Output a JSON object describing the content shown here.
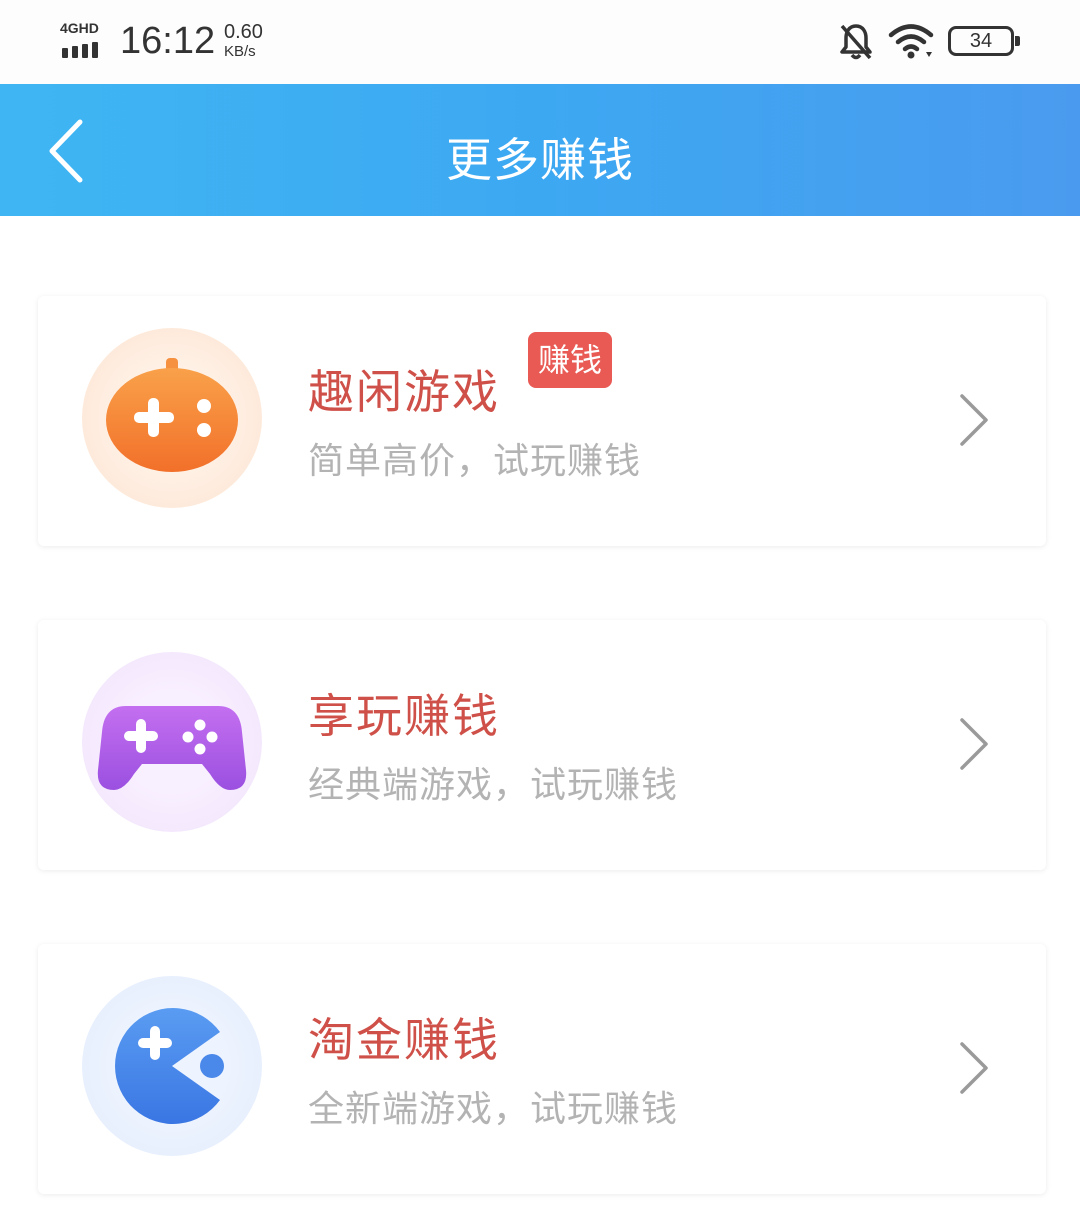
{
  "status_bar": {
    "network": "4GHD",
    "time": "16:12",
    "speed_value": "0.60",
    "speed_unit": "KB/s",
    "battery": "34"
  },
  "header": {
    "title": "更多赚钱"
  },
  "items": [
    {
      "title": "趣闲游戏",
      "subtitle": "简单高价，试玩赚钱",
      "badge": "赚钱",
      "icon": "orange-gamepad-icon",
      "accent": "#f47e2f"
    },
    {
      "title": "享玩赚钱",
      "subtitle": "经典端游戏，试玩赚钱",
      "icon": "purple-controller-icon",
      "accent": "#a25ae6"
    },
    {
      "title": "淘金赚钱",
      "subtitle": "全新端游戏，试玩赚钱",
      "icon": "blue-pacman-icon",
      "accent": "#3f84ea"
    }
  ],
  "colors": {
    "header_start": "#3fb6f3",
    "header_end": "#4a9bef",
    "title_red": "#cf5048",
    "subtitle_gray": "#b3b3b3",
    "badge_red": "#e85a53"
  }
}
